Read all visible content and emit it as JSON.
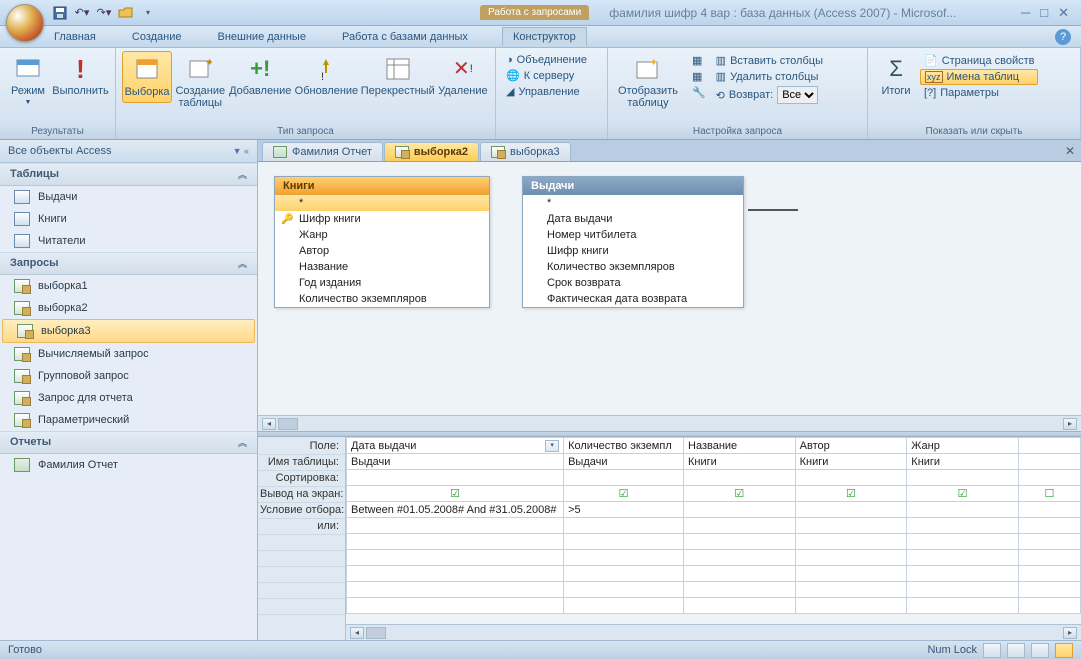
{
  "titlebar": {
    "context_label": "Работа с запросами",
    "title": "фамилия шифр 4 вар : база данных (Access 2007) - Microsof..."
  },
  "menu": {
    "tabs": [
      "Главная",
      "Создание",
      "Внешние данные",
      "Работа с базами данных"
    ],
    "context_tab": "Конструктор"
  },
  "ribbon": {
    "results": {
      "label": "Результаты",
      "view": "Режим",
      "run": "Выполнить"
    },
    "querytype": {
      "label": "Тип запроса",
      "select": "Выборка",
      "maketable": "Создание\nтаблицы",
      "append": "Добавление",
      "update": "Обновление",
      "crosstab": "Перекрестный",
      "delete": "Удаление"
    },
    "querysetup_small": {
      "union": "Объединение",
      "passthrough": "К серверу",
      "datadef": "Управление"
    },
    "showtable": {
      "label": "Настройка запроса",
      "btn": "Отобразить\nтаблицу",
      "insrows": "Вставить столбцы",
      "delrows": "Удалить столбцы",
      "return": "Возврат:",
      "return_val": "Все"
    },
    "showhide": {
      "label": "Показать или скрыть",
      "totals": "Итоги",
      "prop": "Страница свойств",
      "tnames": "Имена таблиц",
      "params": "Параметры"
    }
  },
  "nav": {
    "header": "Все объекты Access",
    "cat_tables": "Таблицы",
    "tables": [
      "Выдачи",
      "Книги",
      "Читатели"
    ],
    "cat_queries": "Запросы",
    "queries": [
      "выборка1",
      "выборка2",
      "выборка3",
      "Вычисляемый запрос",
      "Групповой запрос",
      "Запрос для отчета",
      "Параметрический"
    ],
    "cat_reports": "Отчеты",
    "reports": [
      "Фамилия Отчет"
    ]
  },
  "doctabs": {
    "t0": "Фамилия Отчет",
    "t1": "выборка2",
    "t2": "выборка3"
  },
  "designer": {
    "tbl1": {
      "title": "Книги",
      "fields": [
        "*",
        "Шифр книги",
        "Жанр",
        "Автор",
        "Название",
        "Год издания",
        "Количество экземпляров"
      ]
    },
    "tbl2": {
      "title": "Выдачи",
      "fields": [
        "*",
        "Дата выдачи",
        "Номер читбилета",
        "Шифр книги",
        "Количество экземпляров",
        "Срок возврата",
        "Фактическая дата возврата"
      ]
    }
  },
  "grid": {
    "labels": {
      "field": "Поле:",
      "table": "Имя таблицы:",
      "sort": "Сортировка:",
      "show": "Вывод на экран:",
      "criteria": "Условие отбора:",
      "or": "или:"
    },
    "cols": [
      {
        "field": "Дата выдачи",
        "table": "Выдачи",
        "show": true,
        "criteria": "Between #01.05.2008# And #31.05.2008#",
        "dd": true
      },
      {
        "field": "Количество экземпл",
        "table": "Выдачи",
        "show": true,
        "criteria": ">5"
      },
      {
        "field": "Название",
        "table": "Книги",
        "show": true,
        "criteria": ""
      },
      {
        "field": "Автор",
        "table": "Книги",
        "show": true,
        "criteria": ""
      },
      {
        "field": "Жанр",
        "table": "Книги",
        "show": true,
        "criteria": ""
      }
    ]
  },
  "status": {
    "ready": "Готово",
    "numlock": "Num Lock"
  }
}
